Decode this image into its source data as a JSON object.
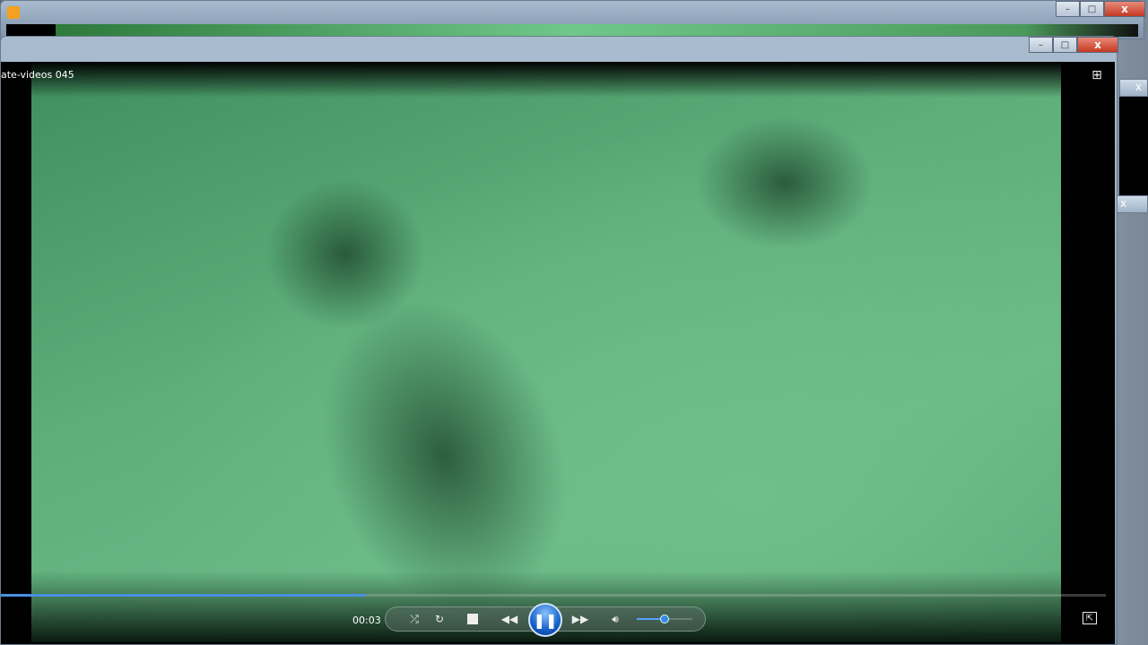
{
  "back_window": {
    "close": "x",
    "minimize": "–",
    "maximize": "□"
  },
  "player": {
    "title": "ate-videos 045",
    "time": "00:03",
    "progress_fraction": 0.33,
    "volume_fraction": 0.5,
    "close": "x",
    "minimize": "–",
    "maximize": "□"
  },
  "side_windows": {
    "close": "x"
  }
}
